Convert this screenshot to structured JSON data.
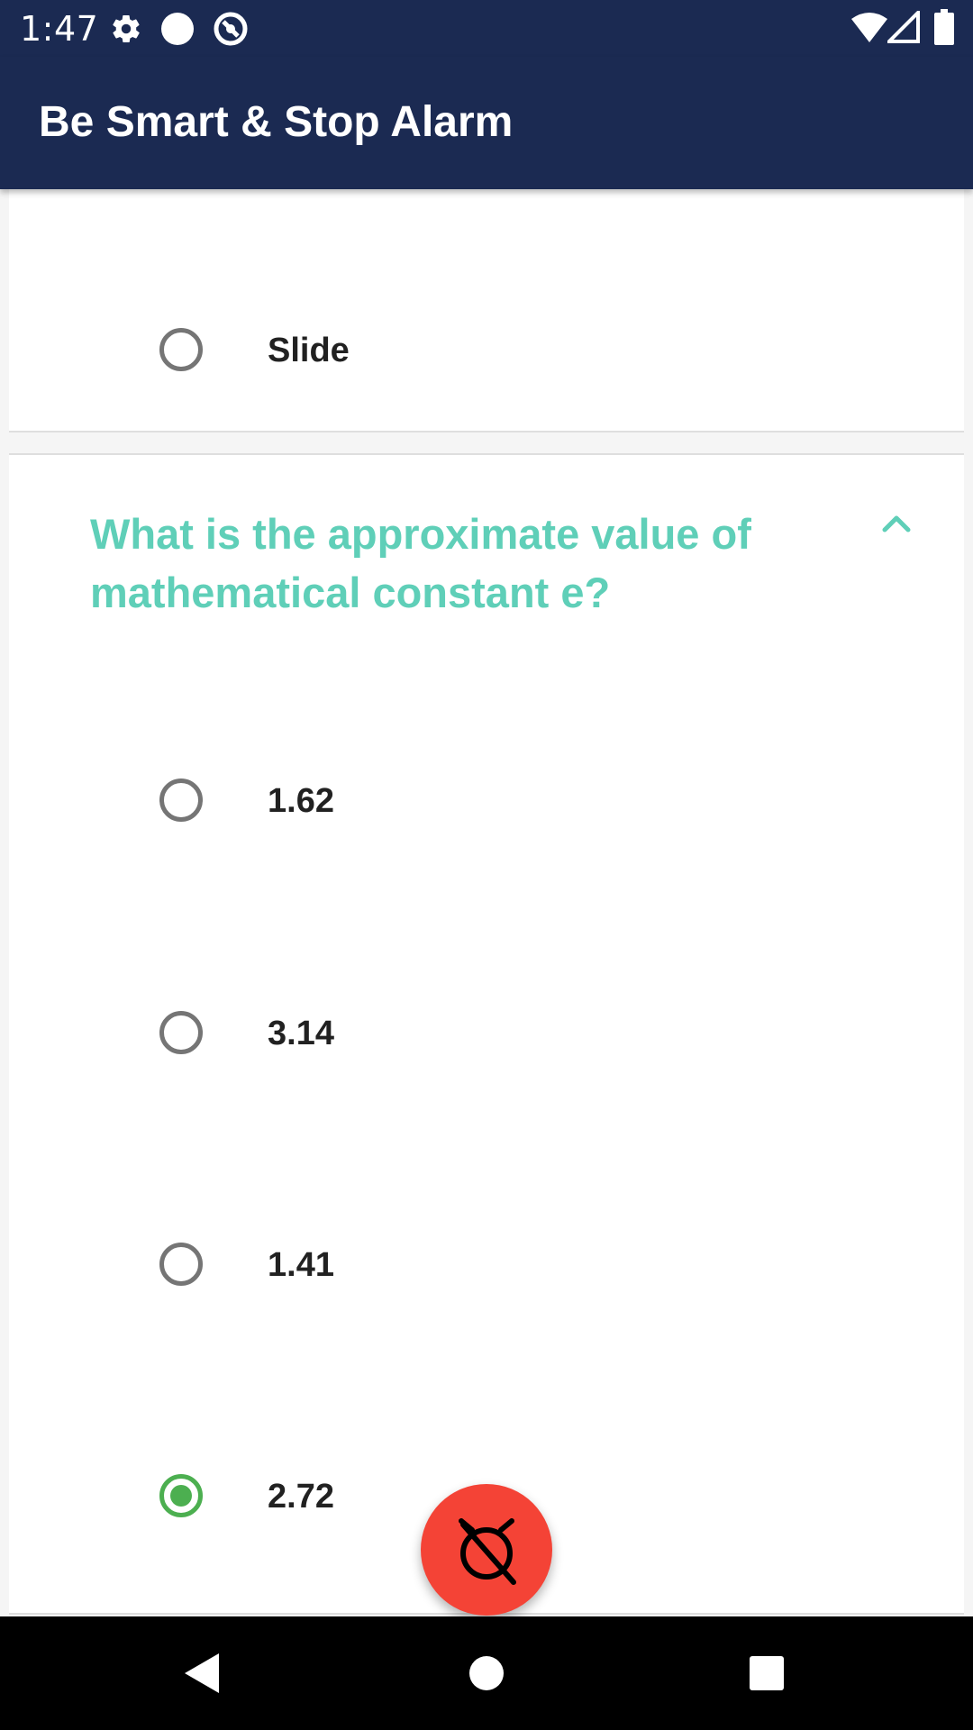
{
  "status_bar": {
    "time": "1:47",
    "icons": [
      "gear-icon",
      "circle-icon",
      "at-icon",
      "wifi-icon",
      "signal-icon",
      "battery-icon"
    ]
  },
  "app_bar": {
    "title": "Be Smart & Stop Alarm"
  },
  "previous_question": {
    "options": [
      {
        "label": "Slide",
        "selected": false
      }
    ]
  },
  "question": {
    "text": "What is the approximate value of mathematical constant e?",
    "expanded": true,
    "options": [
      {
        "label": "1.62",
        "selected": false
      },
      {
        "label": "3.14",
        "selected": false
      },
      {
        "label": "1.41",
        "selected": false
      },
      {
        "label": "2.72",
        "selected": true
      }
    ]
  },
  "fab": {
    "icon": "alarm-off-icon"
  },
  "nav_bar": {
    "icons": [
      "back-icon",
      "home-icon",
      "recents-icon"
    ]
  },
  "colors": {
    "primary": "#1b2a52",
    "question_accent": "#5fcfb8",
    "selected_radio": "#4caf50",
    "fab": "#f44336"
  }
}
